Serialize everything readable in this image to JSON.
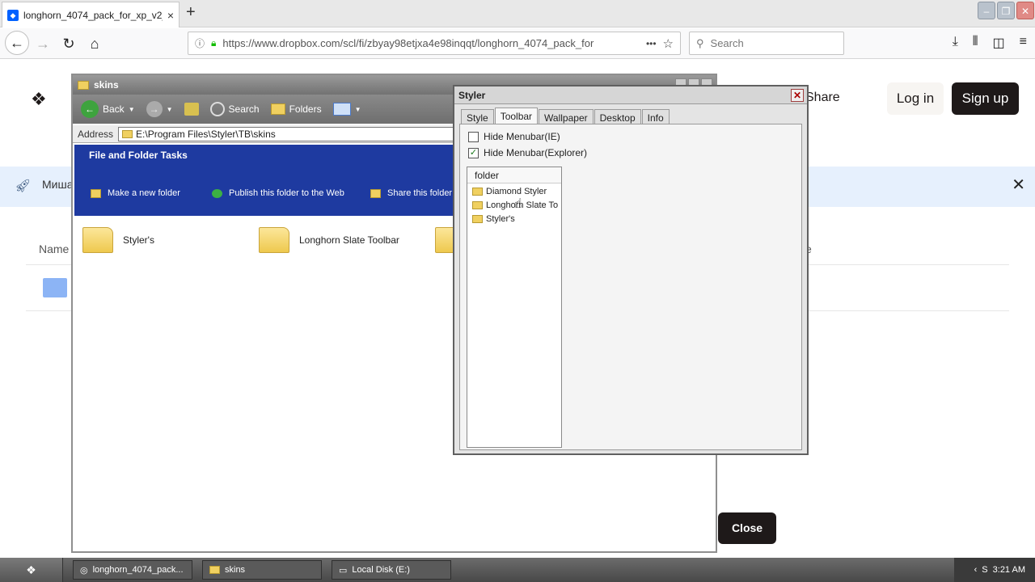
{
  "browser": {
    "tab_title": "longhorn_4074_pack_for_xp_v2_",
    "tab_close": "×",
    "new_tab": "+",
    "url": "https://www.dropbox.com/scl/fi/zbyay98etjxa4e98inqqt/longhorn_4074_pack_for",
    "url_more": "•••",
    "search_placeholder": "Search"
  },
  "dropbox": {
    "share": "Share",
    "login": "Log in",
    "signup": "Sign up",
    "banner_text": "Миша",
    "col_name": "Name",
    "col_size": "ze",
    "close_button": "Close"
  },
  "explorer": {
    "title": "skins",
    "back": "Back",
    "search": "Search",
    "folders": "Folders",
    "address_label": "Address",
    "address": "E:\\Program Files\\Styler\\TB\\skins",
    "tasks_title": "File and Folder Tasks",
    "tasks": [
      "Make a new folder",
      "Publish this folder to the Web",
      "Share this folder"
    ],
    "items": [
      "Styler's",
      "Longhorn Slate Toolbar"
    ]
  },
  "styler": {
    "title": "Styler",
    "tabs": [
      "Style",
      "Toolbar",
      "Wallpaper",
      "Desktop",
      "Info"
    ],
    "active_tab": "Toolbar",
    "check_ie": "Hide Menubar(IE)",
    "check_explorer": "Hide Menubar(Explorer)",
    "list_header": "folder",
    "list_items": [
      "Diamond Styler",
      "Longhorn Slate To",
      "Styler's"
    ]
  },
  "taskbar": {
    "tasks": [
      "longhorn_4074_pack...",
      "skins",
      "Local Disk (E:)"
    ],
    "time": "3:21 AM"
  },
  "colors": {
    "dropbox_dark": "#1e1919",
    "xp_task_blue": "#1e3aa0"
  }
}
